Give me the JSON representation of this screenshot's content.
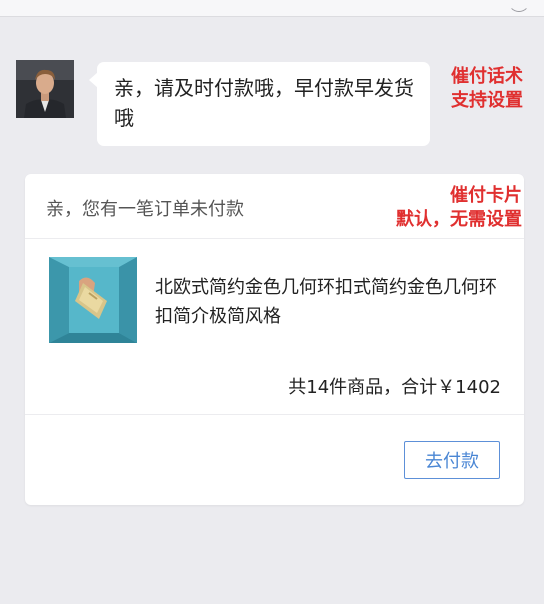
{
  "message": {
    "text": "亲，请及时付款哦，早付款早发货哦"
  },
  "annotations": {
    "script_note": [
      "催付话术",
      "支持设置"
    ],
    "card_note": [
      "催付卡片",
      "默认，无需设置"
    ],
    "color": "#e03030"
  },
  "order_card": {
    "header": "亲，您有一笔订单未付款",
    "product_title": "北欧式简约金色几何环扣式简约金色几何环扣简介极简风格",
    "summary": "共14件商品，合计￥1402",
    "pay_button": "去付款",
    "accent": "#4a86d4"
  }
}
